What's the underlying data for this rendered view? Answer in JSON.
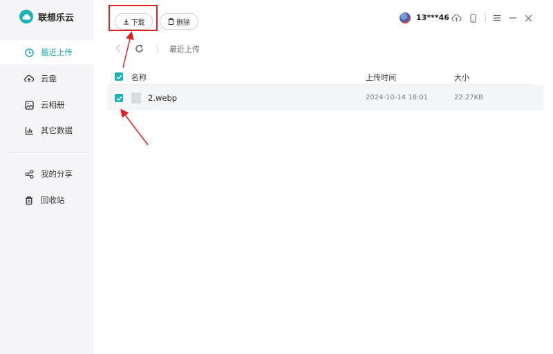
{
  "app": {
    "name": "联想乐云"
  },
  "sidebar": {
    "items": [
      {
        "label": "最近上传",
        "active": true
      },
      {
        "label": "云盘"
      },
      {
        "label": "云相册"
      },
      {
        "label": "其它数据"
      },
      {
        "label": "我的分享"
      },
      {
        "label": "回收站"
      }
    ]
  },
  "toolbar": {
    "download_label": "下载",
    "delete_label": "删除"
  },
  "user": {
    "name": "13***46"
  },
  "breadcrumb": {
    "current": "最近上传"
  },
  "table": {
    "headers": {
      "name": "名称",
      "time": "上传时间",
      "size": "大小"
    },
    "rows": [
      {
        "name": "2.webp",
        "time": "2024-10-14 18:01",
        "size": "22.27KB",
        "checked": true
      }
    ]
  },
  "colors": {
    "accent": "#1db1b8",
    "annotation": "#e02020"
  }
}
